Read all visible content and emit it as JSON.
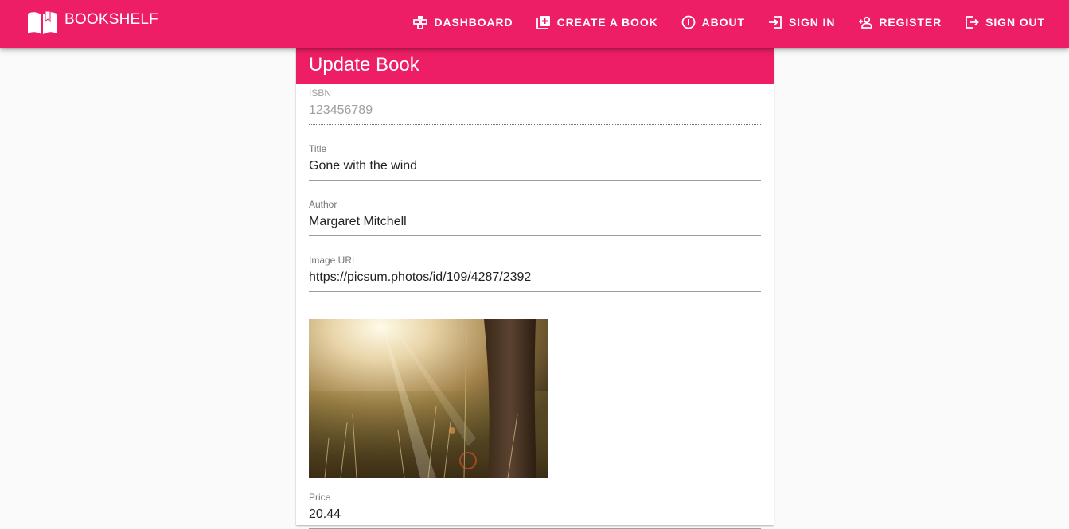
{
  "appbar": {
    "brand_label": "BOOKSHELF",
    "brand_icon": "open-book-icon",
    "nav": [
      {
        "label": "DASHBOARD",
        "icon": "dashboard-icon"
      },
      {
        "label": "CREATE A BOOK",
        "icon": "library-add-icon"
      },
      {
        "label": "ABOUT",
        "icon": "info-icon"
      },
      {
        "label": "SIGN IN",
        "icon": "sign-in-icon"
      },
      {
        "label": "REGISTER",
        "icon": "person-add-icon"
      },
      {
        "label": "SIGN OUT",
        "icon": "sign-out-icon"
      }
    ]
  },
  "form": {
    "title": "Update Book",
    "isbn": {
      "label": "ISBN",
      "value": "123456789"
    },
    "book_title": {
      "label": "Title",
      "value": "Gone with the wind"
    },
    "author": {
      "label": "Author",
      "value": "Margaret Mitchell"
    },
    "image_url": {
      "label": "Image URL",
      "value": "https://picsum.photos/id/109/4287/2392"
    },
    "price": {
      "label": "Price",
      "value": "20.44"
    }
  },
  "colors": {
    "primary": "#ed1e65",
    "background": "#fafafa"
  }
}
